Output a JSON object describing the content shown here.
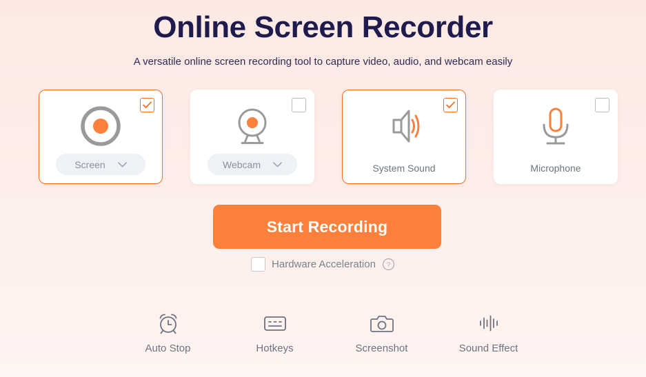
{
  "header": {
    "title": "Online Screen Recorder",
    "subtitle": "A versatile online screen recording tool to capture video, audio, and webcam easily"
  },
  "colors": {
    "accent": "#fb803c",
    "accent_border": "#f37021",
    "title": "#1f1b4d",
    "muted_text": "#6c7280",
    "card_bg": "#ffffff",
    "pill_bg": "#eef2f7",
    "background_top": "#fce9e3",
    "background_bottom": "#fef4f1"
  },
  "sources": [
    {
      "name": "screen",
      "icon": "record-circle-icon",
      "label": "Screen",
      "selected": true,
      "checkbox": "checked",
      "has_dropdown": true,
      "dropdown_icon": "chevron-down-icon"
    },
    {
      "name": "webcam",
      "icon": "webcam-icon",
      "label": "Webcam",
      "selected": false,
      "checkbox": "unchecked",
      "has_dropdown": true,
      "dropdown_icon": "chevron-down-icon"
    },
    {
      "name": "system-sound",
      "icon": "speaker-icon",
      "label": "System Sound",
      "selected": true,
      "checkbox": "checked",
      "has_dropdown": false
    },
    {
      "name": "microphone",
      "icon": "microphone-icon",
      "label": "Microphone",
      "selected": false,
      "checkbox": "unchecked",
      "has_dropdown": false
    }
  ],
  "action": {
    "start_label": "Start Recording",
    "hardware_acceleration_label": "Hardware Acceleration",
    "hardware_acceleration_checked": false,
    "help_icon": "question-mark-circle-icon"
  },
  "toolbar": [
    {
      "name": "auto-stop",
      "label": "Auto Stop",
      "icon": "alarm-clock-icon"
    },
    {
      "name": "hotkeys",
      "label": "Hotkeys",
      "icon": "keyboard-icon"
    },
    {
      "name": "screenshot",
      "label": "Screenshot",
      "icon": "camera-icon"
    },
    {
      "name": "sound-effect",
      "label": "Sound Effect",
      "icon": "waveform-icon"
    }
  ]
}
